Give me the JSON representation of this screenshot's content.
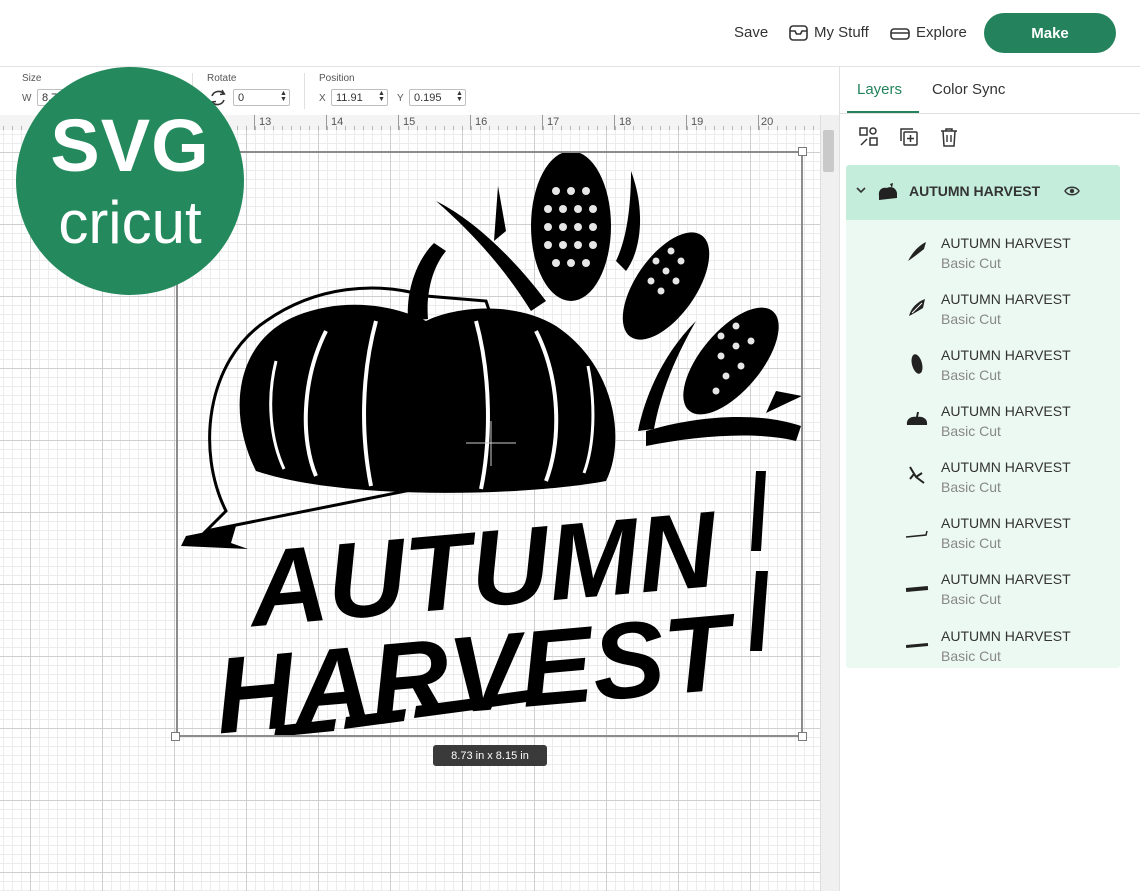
{
  "topbar": {
    "save_label": "Save",
    "mystuff_label": "My Stuff",
    "explore_label": "Explore",
    "make_label": "Make"
  },
  "toolbar": {
    "size_label": "Size",
    "w_label": "W",
    "w_value": "8.73",
    "rotate_label": "Rotate",
    "rotate_value": "0",
    "position_label": "Position",
    "x_label": "X",
    "x_value": "11.91",
    "y_label": "Y",
    "y_value": "0.195"
  },
  "ruler": {
    "numbers": [
      "13",
      "14",
      "15",
      "16",
      "17",
      "18",
      "19",
      "20"
    ]
  },
  "canvas": {
    "dimensions_badge": "8.73  in x 8.15  in",
    "design_line1": "AUTUMN",
    "design_line2": "HARVEST"
  },
  "logo": {
    "line1": "SVG",
    "line2": "cricut"
  },
  "panel": {
    "tabs": [
      "Layers",
      "Color Sync"
    ],
    "group_title": "AUTUMN HARVEST",
    "layers": [
      {
        "name": "AUTUMN HARVEST",
        "type": "Basic Cut",
        "icon": "corn-leaf-icon"
      },
      {
        "name": "AUTUMN HARVEST",
        "type": "Basic Cut",
        "icon": "corn-husk-icon"
      },
      {
        "name": "AUTUMN HARVEST",
        "type": "Basic Cut",
        "icon": "corn-cob-icon"
      },
      {
        "name": "AUTUMN HARVEST",
        "type": "Basic Cut",
        "icon": "pumpkin-icon"
      },
      {
        "name": "AUTUMN HARVEST",
        "type": "Basic Cut",
        "icon": "stem-icon"
      },
      {
        "name": "AUTUMN HARVEST",
        "type": "Basic Cut",
        "icon": "outline-icon"
      },
      {
        "name": "AUTUMN HARVEST",
        "type": "Basic Cut",
        "icon": "harvest-text-icon"
      },
      {
        "name": "AUTUMN HARVEST",
        "type": "Basic Cut",
        "icon": "autumn-text-icon"
      }
    ]
  },
  "colors": {
    "brand_green": "#24835c",
    "layer_group_bg": "#c4eedb",
    "layer_list_bg": "#ecf9f3"
  }
}
